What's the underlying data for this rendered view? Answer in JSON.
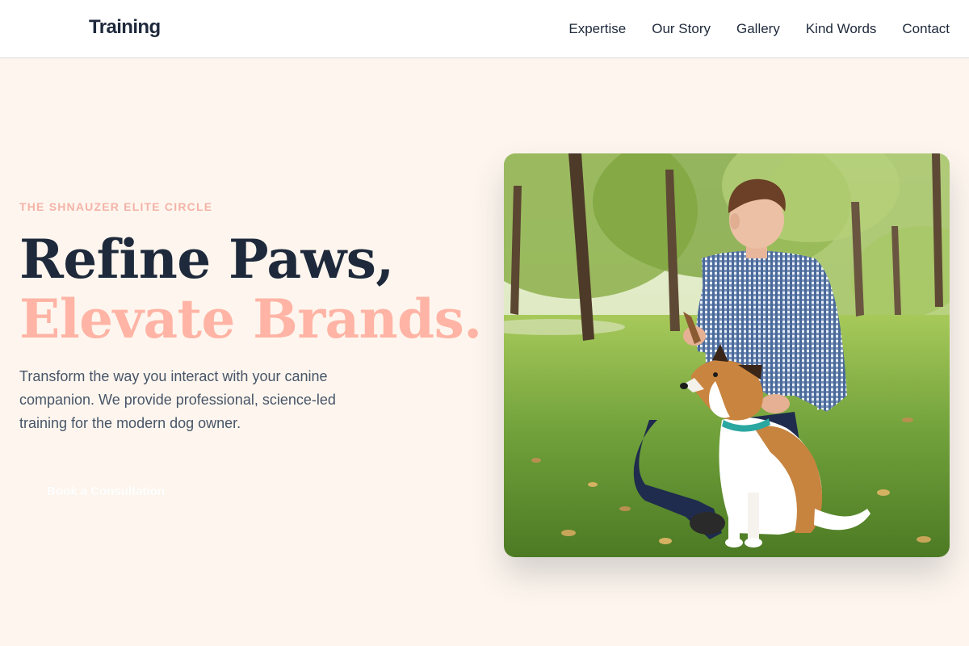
{
  "header": {
    "brand": "Training",
    "nav": [
      "Expertise",
      "Our Story",
      "Gallery",
      "Kind Words",
      "Contact"
    ]
  },
  "hero": {
    "eyebrow": "THE SHNAUZER ELITE CIRCLE",
    "headline_line1": "Refine Paws,",
    "headline_line2": "Elevate Brands.",
    "lead": "Transform the way you interact with your canine companion. We provide professional, science-led training for the modern dog owner.",
    "cta_label": "Book a Consultation"
  },
  "colors": {
    "page_background": "#FEF6EE",
    "headline_dark": "#1E293B",
    "headline_accent": "#FFB4A5",
    "eyebrow": "#F4B3A8",
    "body_text": "#475569"
  },
  "image": {
    "subject": "man in checked shirt kneeling in park beside sitting dog"
  }
}
